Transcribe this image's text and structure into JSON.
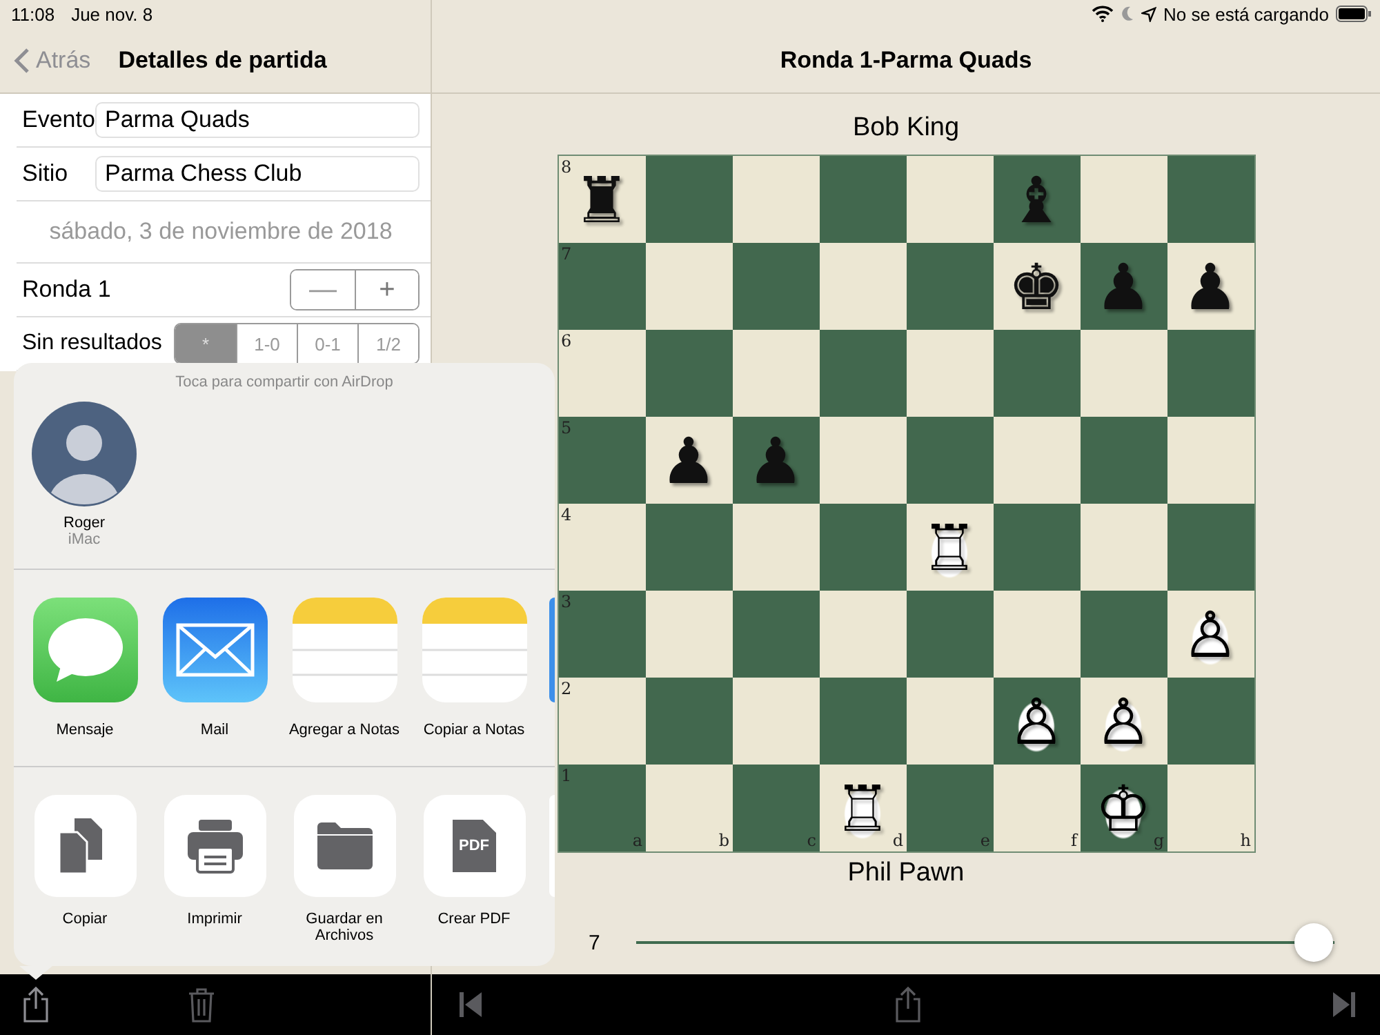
{
  "status_bar": {
    "time": "11:08",
    "date": "Jue nov. 8",
    "charging": "No se está cargando"
  },
  "details": {
    "back": "Atrás",
    "title": "Detalles de partida",
    "fields": [
      {
        "label": "Evento",
        "value": "Parma Quads"
      },
      {
        "label": "Sitio",
        "value": "Parma Chess Club"
      }
    ],
    "date": "sábado, 3 de noviembre de 2018",
    "round": {
      "label": "Ronda 1",
      "buttons": [
        "—",
        "+"
      ]
    },
    "result": {
      "label": "Sin resultados",
      "segments": [
        {
          "label": "*",
          "selected": true
        },
        {
          "label": "1-0",
          "selected": false
        },
        {
          "label": "0-1",
          "selected": false
        },
        {
          "label": "1/2",
          "selected": false
        }
      ]
    }
  },
  "share_sheet": {
    "airdrop_hint": "Toca para compartir con AirDrop",
    "contacts": [
      {
        "name": "Roger",
        "device": "iMac"
      }
    ],
    "apps": [
      {
        "kind": "messages",
        "label": "Mensaje"
      },
      {
        "kind": "mail",
        "label": "Mail"
      },
      {
        "kind": "notes",
        "label": "Agregar a Notas"
      },
      {
        "kind": "notes",
        "label": "Copiar a Notas"
      }
    ],
    "actions": [
      {
        "kind": "copy",
        "label": "Copiar"
      },
      {
        "kind": "print",
        "label": "Imprimir"
      },
      {
        "kind": "folder",
        "label": "Guardar en Archivos"
      },
      {
        "kind": "pdf",
        "label": "Crear PDF",
        "icon_text": "PDF"
      }
    ]
  },
  "game": {
    "title": "Ronda 1-Parma Quads",
    "black_player": "Bob King",
    "white_player": "Phil Pawn",
    "files": [
      "a",
      "b",
      "c",
      "d",
      "e",
      "f",
      "g",
      "h"
    ],
    "ranks": [
      {
        "label": "8",
        "cells": [
          {
            "glyph": "♜",
            "white": false
          },
          null,
          null,
          null,
          null,
          {
            "glyph": "♝",
            "white": false
          },
          null,
          null
        ]
      },
      {
        "label": "7",
        "cells": [
          null,
          null,
          null,
          null,
          null,
          {
            "glyph": "♚",
            "white": false
          },
          {
            "glyph": "♟",
            "white": false
          },
          {
            "glyph": "♟",
            "white": false
          }
        ]
      },
      {
        "label": "6",
        "cells": [
          null,
          null,
          null,
          null,
          null,
          null,
          null,
          null
        ]
      },
      {
        "label": "5",
        "cells": [
          null,
          {
            "glyph": "♟",
            "white": false
          },
          {
            "glyph": "♟",
            "white": false
          },
          null,
          null,
          null,
          null,
          null
        ]
      },
      {
        "label": "4",
        "cells": [
          null,
          null,
          null,
          null,
          {
            "glyph": "♖",
            "white": true
          },
          null,
          null,
          null
        ]
      },
      {
        "label": "3",
        "cells": [
          null,
          null,
          null,
          null,
          null,
          null,
          null,
          {
            "glyph": "♙",
            "white": true
          }
        ]
      },
      {
        "label": "2",
        "cells": [
          null,
          null,
          null,
          null,
          null,
          {
            "glyph": "♙",
            "white": true
          },
          {
            "glyph": "♙",
            "white": true
          },
          null
        ]
      },
      {
        "label": "1",
        "cells": [
          null,
          null,
          null,
          {
            "glyph": "♖",
            "white": true
          },
          null,
          null,
          {
            "glyph": "♔",
            "white": true
          },
          null
        ]
      }
    ],
    "move_number": "7",
    "slider": {
      "level": 1.0
    }
  }
}
